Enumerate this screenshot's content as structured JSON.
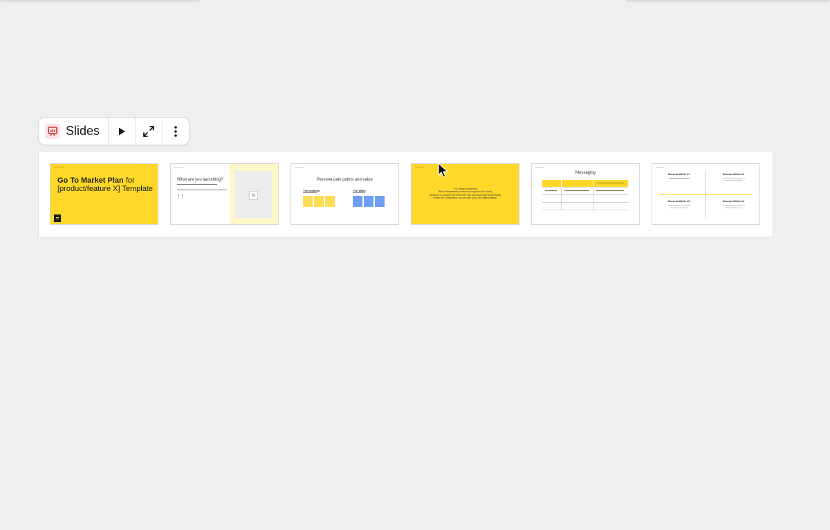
{
  "toolbar": {
    "title": "Slides",
    "icon": "presentation-icon",
    "buttons": [
      {
        "name": "present",
        "icon": "play-icon"
      },
      {
        "name": "fullscreen",
        "icon": "expand-icon"
      },
      {
        "name": "more",
        "icon": "more-vertical-icon"
      }
    ]
  },
  "slides": [
    {
      "background": "#FFD829",
      "title_bold": "Go To Market Plan",
      "title_rest": " for [product/feature X] Template"
    },
    {
      "background": "#FFFFFF",
      "heading": "What are you launching?"
    },
    {
      "background": "#FFFFFF",
      "heading": "Persona pain points and value",
      "label_left": "The problem",
      "label_right": "The Value",
      "left_color": "#FFDD57",
      "right_color": "#6F9DF2"
    },
    {
      "background": "#FFD829",
      "lines": [
        "For (target audience)",
        "Who wants/needs (reason to buy/job to be done),",
        "(feature) is a (frame of reference) that provides (your key benefit).",
        "Unlike the competition, we provide (your key differentiator)."
      ]
    },
    {
      "background": "#FFFFFF",
      "heading": "Messaging"
    },
    {
      "background": "#FFFFFF",
      "metrics": [
        {
          "title": "Success Metric #1"
        },
        {
          "title": "Success Metric #2"
        },
        {
          "title": "Success Metric #3"
        },
        {
          "title": "Success Metric #4"
        }
      ]
    }
  ]
}
